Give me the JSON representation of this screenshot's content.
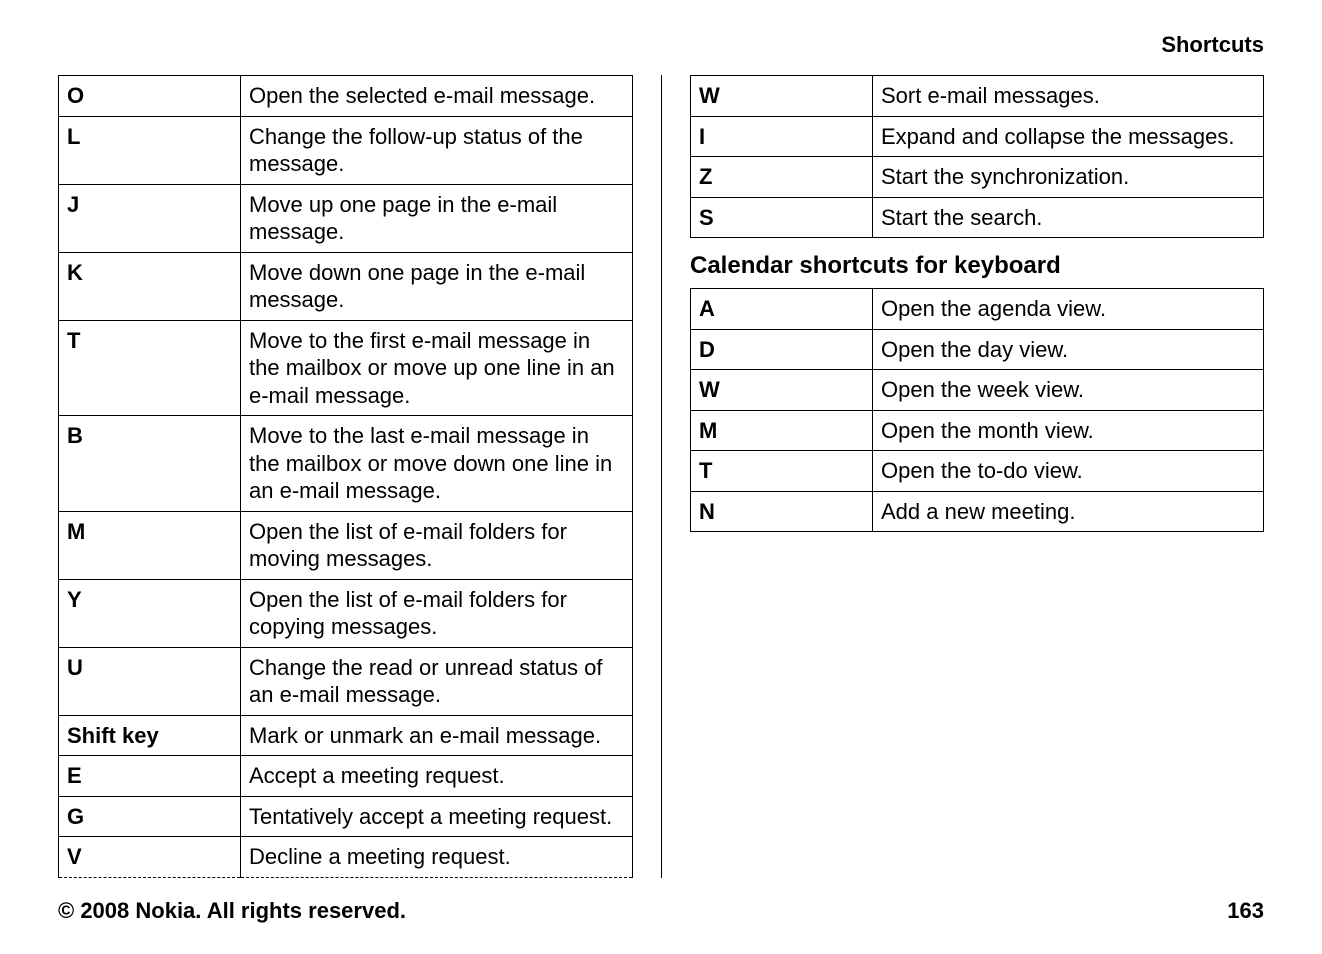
{
  "header": {
    "title": "Shortcuts"
  },
  "left_table": {
    "rows": [
      {
        "key": "O",
        "desc": "Open the selected e-mail message."
      },
      {
        "key": "L",
        "desc": "Change the follow-up status of the message."
      },
      {
        "key": "J",
        "desc": "Move up one page in the e-mail message."
      },
      {
        "key": "K",
        "desc": "Move down one page in the e-mail message."
      },
      {
        "key": "T",
        "desc": "Move to the first e-mail message in the mailbox or move up one line in an e-mail message."
      },
      {
        "key": "B",
        "desc": "Move to the last e-mail message in the mailbox or move down one line in an e-mail message."
      },
      {
        "key": "M",
        "desc": "Open the list of e-mail folders for moving messages."
      },
      {
        "key": "Y",
        "desc": "Open the list of e-mail folders for copying messages."
      },
      {
        "key": "U",
        "desc": "Change the read or unread status of an e-mail message."
      },
      {
        "key": "Shift key",
        "desc": "Mark or unmark an e-mail message."
      },
      {
        "key": "E",
        "desc": "Accept a meeting request."
      },
      {
        "key": "G",
        "desc": "Tentatively accept a meeting request."
      },
      {
        "key": "V",
        "desc": "Decline a meeting request."
      }
    ]
  },
  "right_top_table": {
    "rows": [
      {
        "key": "W",
        "desc": "Sort e-mail messages."
      },
      {
        "key": "I",
        "desc": "Expand and collapse the messages."
      },
      {
        "key": "Z",
        "desc": "Start the synchronization."
      },
      {
        "key": "S",
        "desc": "Start the search."
      }
    ]
  },
  "right_section_title": "Calendar shortcuts for keyboard",
  "right_bottom_table": {
    "rows": [
      {
        "key": "A",
        "desc": "Open the agenda view."
      },
      {
        "key": "D",
        "desc": "Open the day view."
      },
      {
        "key": "W",
        "desc": "Open the week view."
      },
      {
        "key": "M",
        "desc": "Open the month view."
      },
      {
        "key": "T",
        "desc": "Open the to-do view."
      },
      {
        "key": "N",
        "desc": "Add a new meeting."
      }
    ]
  },
  "footer": {
    "copyright": "© 2008 Nokia. All rights reserved.",
    "page_number": "163"
  }
}
